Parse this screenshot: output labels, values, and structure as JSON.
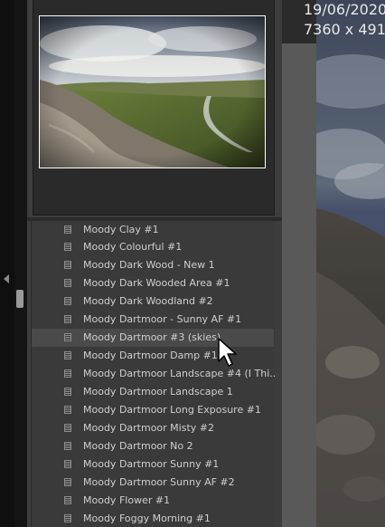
{
  "info_overlay": {
    "date": "19/06/2020",
    "dimensions": "7360 x 491"
  },
  "presets": [
    {
      "label": "Moody Clay #1"
    },
    {
      "label": "Moody Colourful #1"
    },
    {
      "label": "Moody Dark Wood - New 1"
    },
    {
      "label": "Moody Dark Wooded Area #1"
    },
    {
      "label": "Moody Dark Woodland #2"
    },
    {
      "label": "Moody Dartmoor - Sunny AF #1"
    },
    {
      "label": "Moody Dartmoor #3 (skies)",
      "hovered": true
    },
    {
      "label": "Moody Dartmoor Damp #1"
    },
    {
      "label": "Moody Dartmoor Landscape #4 (I Thi..."
    },
    {
      "label": "Moody Dartmoor Landscape 1"
    },
    {
      "label": "Moody Dartmoor Long Exposure #1"
    },
    {
      "label": "Moody Dartmoor Misty #2"
    },
    {
      "label": "Moody Dartmoor No 2"
    },
    {
      "label": "Moody Dartmoor Sunny #1"
    },
    {
      "label": "Moody Dartmoor Sunny AF #2"
    },
    {
      "label": "Moody Flower #1"
    },
    {
      "label": "Moody Foggy Morning #1"
    }
  ],
  "icons": {
    "left_panel_toggle": "triangle-left-icon",
    "preset_item": "preset-document-icon",
    "cursor": "mouse-pointer-icon"
  },
  "colors": {
    "panel_bg": "#3d3d3d",
    "list_bg": "#3a3a3a",
    "hover_bg": "#4a4a4a",
    "text": "#cfcfcf"
  }
}
